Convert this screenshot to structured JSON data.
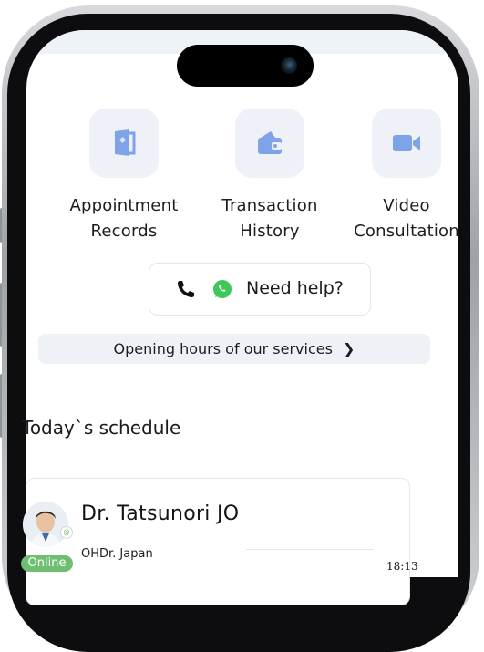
{
  "quick_actions": [
    {
      "label_line1": "Appointment",
      "label_line2": "Records",
      "icon": "appointment-records-icon"
    },
    {
      "label_line1": "Transaction",
      "label_line2": "History",
      "icon": "wallet-icon"
    },
    {
      "label_line1": "Video",
      "label_line2": "Consultation",
      "icon": "video-camera-icon"
    }
  ],
  "help": {
    "label": "Need help?",
    "icons": [
      "phone-icon",
      "whatsapp-icon"
    ]
  },
  "opening_hours": {
    "label": "Opening hours of our services",
    "icon": "chevron-right-icon"
  },
  "schedule": {
    "title": "Today`s schedule",
    "doctor": {
      "name": "Dr. Tatsunori JO",
      "organization": "OHDr. Japan",
      "status": "Online"
    }
  },
  "status_time": "18:13",
  "colors": {
    "tile_bg": "#eef2f8",
    "icon_blue": "#7ea3e8",
    "whatsapp_green": "#3fc75a",
    "online_green": "#6fbf73"
  }
}
